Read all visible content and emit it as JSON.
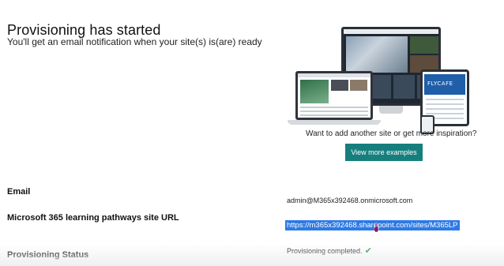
{
  "header": {
    "title": "Provisioning has started",
    "subtitle": "You'll get an email notification when your site(s) is(are) ready"
  },
  "promo": {
    "image_brand_text": "FLYCAFE",
    "question": "Want to add another site or get more inspiration?",
    "button_label": "View more examples",
    "button_color": "#167f7e"
  },
  "fields": {
    "email_label": "Email",
    "email_value": "admin@M365x392468.onmicrosoft.com",
    "site_url_label": "Microsoft 365 learning pathways site URL",
    "site_url_value": "https://m365x392468.sharepoint.com/sites/M365LP",
    "status_label": "Provisioning Status",
    "status_value": "Provisioning completed.",
    "status_icon": "checkmark-icon",
    "status_color": "#2e9a3e"
  }
}
